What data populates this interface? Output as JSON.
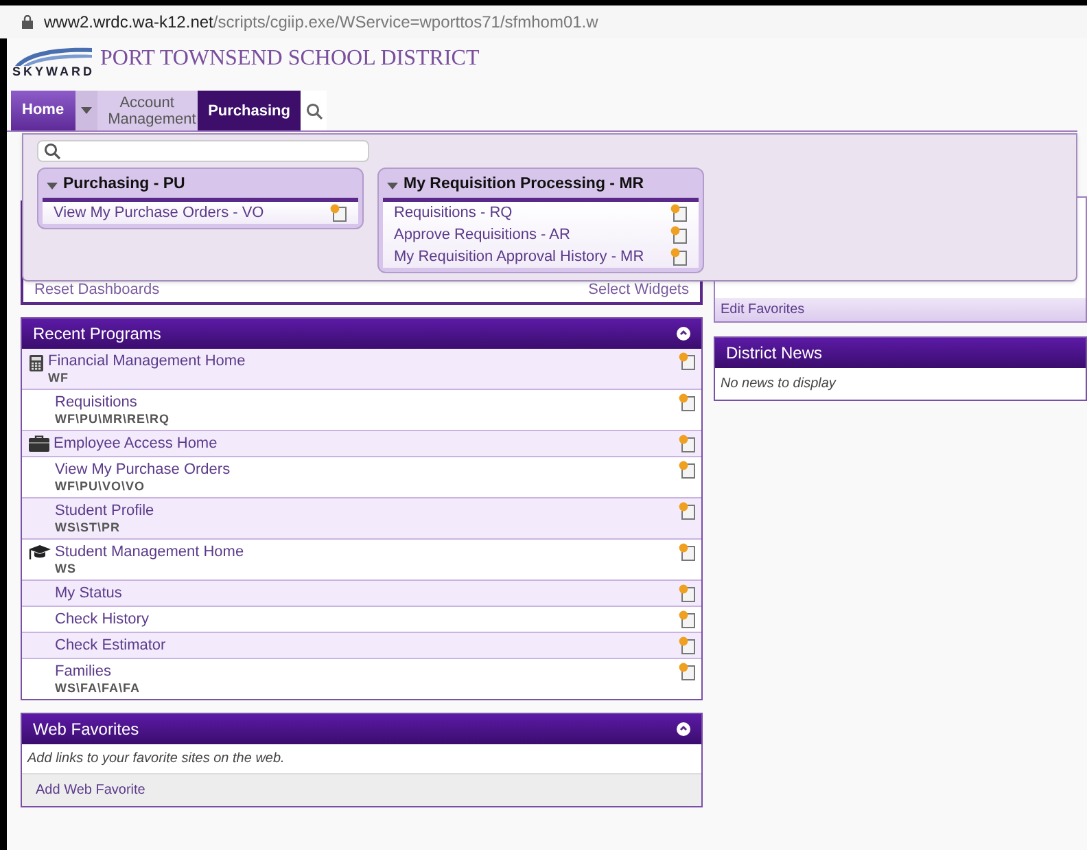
{
  "address_bar": {
    "host": "www2.wrdc.wa-k12.net",
    "path": "/scripts/cgiip.exe/WService=wporttos71/sfmhom01.w"
  },
  "header": {
    "logo": "SKYWARD",
    "district": "PORT TOWNSEND SCHOOL DISTRICT"
  },
  "nav": [
    {
      "label": "Home",
      "kind": "home",
      "selected": false
    },
    {
      "label": "Account Management",
      "kind": "tab",
      "selected": false
    },
    {
      "label": "Purchasing",
      "kind": "tab",
      "selected": true
    }
  ],
  "menu": {
    "groups": [
      {
        "title": "Purchasing - PU",
        "expanded": true,
        "items": [
          "View My Purchase Orders - VO"
        ]
      },
      {
        "title": "My Requisition Processing - MR",
        "expanded": true,
        "items": [
          "Requisitions - RQ",
          "Approve Requisitions - AR",
          "My Requisition Approval History - MR"
        ]
      }
    ]
  },
  "dashboard": {
    "left_link": "Reset Dashboards",
    "right_link": "Select Widgets"
  },
  "favorites": {
    "link": "Edit Favorites"
  },
  "recent_programs": {
    "title": "Recent Programs",
    "rows": [
      {
        "name": "Financial Management Home",
        "code": "WF",
        "kind": "calculator"
      },
      {
        "name": "Requisitions",
        "code": "WF\\PU\\MR\\RE\\RQ",
        "kind": "plain"
      },
      {
        "name": "Employee Access Home",
        "kind": "briefcase"
      },
      {
        "name": "View My Purchase Orders",
        "code": "WF\\PU\\VO\\VO",
        "kind": "plain"
      },
      {
        "name": "Student Profile",
        "code": "WS\\ST\\PR",
        "kind": "plain"
      },
      {
        "name": "Student Management Home",
        "code": "WS",
        "kind": "mortarboard"
      },
      {
        "name": "My Status",
        "kind": "plain"
      },
      {
        "name": "Check History",
        "kind": "plain"
      },
      {
        "name": "Check Estimator",
        "kind": "plain"
      },
      {
        "name": "Families",
        "code": "WS\\FA\\FA\\FA",
        "kind": "plain"
      }
    ]
  },
  "web_favorites": {
    "title": "Web Favorites",
    "note": "Add links to your favorite sites on the web.",
    "action": "Add Web Favorite"
  },
  "district_news": {
    "title": "District News",
    "note": "No news to display"
  }
}
